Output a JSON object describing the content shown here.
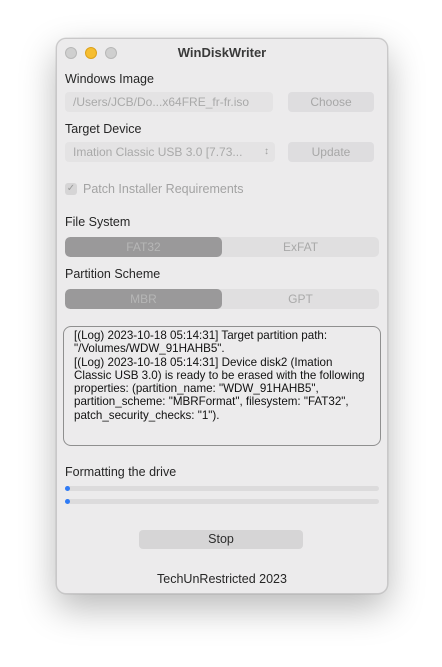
{
  "window": {
    "title": "WinDiskWriter"
  },
  "windows_image": {
    "label": "Windows Image",
    "path": "/Users/JCB/Do...x64FRE_fr-fr.iso",
    "choose_label": "Choose"
  },
  "target_device": {
    "label": "Target Device",
    "selected": "Imation Classic USB 3.0 [7.73...",
    "update_label": "Update"
  },
  "patch": {
    "label": "Patch Installer Requirements",
    "checked": true
  },
  "file_system": {
    "label": "File System",
    "options": [
      "FAT32",
      "ExFAT"
    ],
    "selected": "FAT32"
  },
  "partition_scheme": {
    "label": "Partition Scheme",
    "options": [
      "MBR",
      "GPT"
    ],
    "selected": "MBR"
  },
  "log": {
    "lines": [
      "[(Log) 2023-10-18 05:14:31] Target partition path: \"/Volumes/WDW_91HAHB5\".",
      "[(Log) 2023-10-18 05:14:31] Device disk2 (Imation Classic USB 3.0) is ready to be erased with the following properties: (partition_name: \"WDW_91HAHB5\", partition_scheme: \"MBRFormat\", filesystem: \"FAT32\", patch_security_checks: \"1\")."
    ]
  },
  "status": {
    "text": "Formatting the drive"
  },
  "progress": {
    "bar1_fraction": 0.0,
    "bar2_fraction": 0.0,
    "color": "#2f7bf6"
  },
  "stop_label": "Stop",
  "footer": {
    "text": "TechUnRestricted 2023"
  }
}
